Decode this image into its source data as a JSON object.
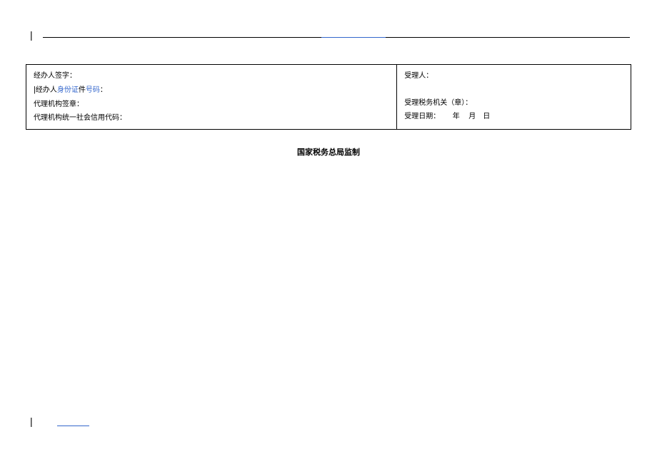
{
  "topCursor": "|",
  "bottomCursor": "|",
  "leftCell": {
    "line1": "经办人签字：",
    "line2_prefix": "经办人",
    "line2_blue1": "身份证",
    "line2_mid": "件",
    "line2_blue2": "号码",
    "line2_suffix": "：",
    "line3": "代理机构签章：",
    "line4": "代理机构统一社会信用代码："
  },
  "rightCell": {
    "line1": "受理人：",
    "line2": "受理税务机关（章）：",
    "line3_label": "受理日期：",
    "line3_year": "年",
    "line3_month": "月",
    "line3_day": "日"
  },
  "footer": "国家税务总局监制"
}
